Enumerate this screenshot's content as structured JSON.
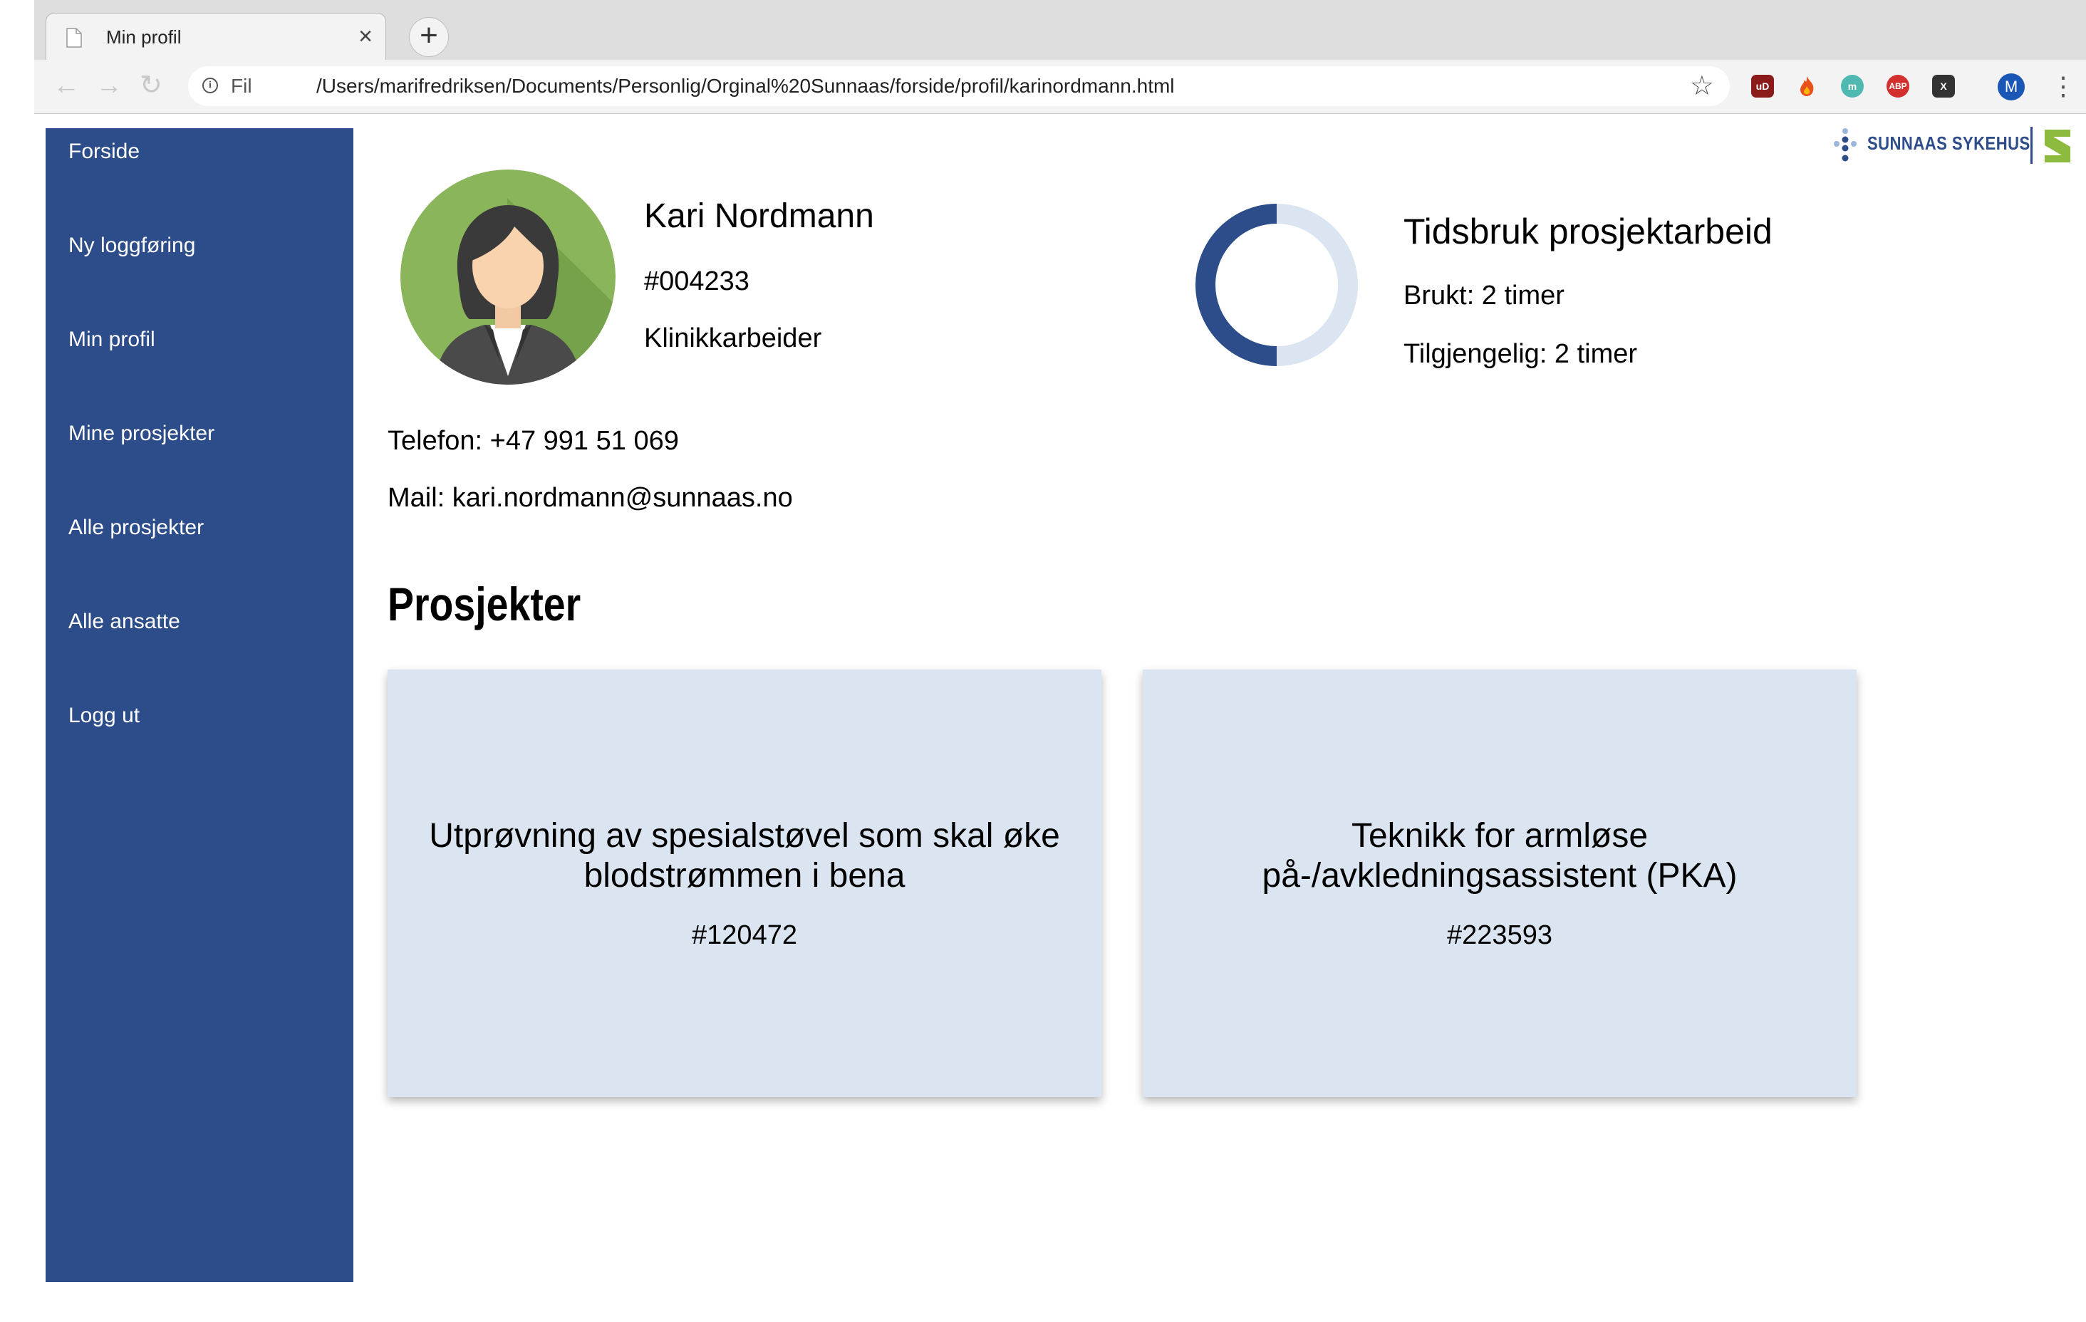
{
  "browser": {
    "tab_title": "Min profil",
    "tab_close": "×",
    "new_tab": "+",
    "scheme_label": "Fil",
    "url": "/Users/marifredriksen/Documents/Personlig/Orginal%20Sunnaas/forside/profil/karinordmann.html",
    "info_icon": "i",
    "extensions": [
      {
        "name": "ublock-icon",
        "label": "uD",
        "color": "#8b1a1a"
      },
      {
        "name": "flame-icon",
        "label": "🔥",
        "color": "transparent"
      },
      {
        "name": "mercury-icon",
        "label": "m",
        "color": "#4fb8b0"
      },
      {
        "name": "adblock-icon",
        "label": "ABP",
        "color": "#d32f2f"
      },
      {
        "name": "x-extension-icon",
        "label": "X",
        "color": "#333333"
      }
    ],
    "avatar_letter": "M"
  },
  "sidebar": {
    "items": [
      {
        "label": "Forside"
      },
      {
        "label": "Ny loggføring"
      },
      {
        "label": "Min profil"
      },
      {
        "label": "Mine prosjekter"
      },
      {
        "label": "Alle prosjekter"
      },
      {
        "label": "Alle ansatte"
      },
      {
        "label": "Logg ut"
      }
    ]
  },
  "logo": {
    "text": "SUNNAAS SYKEHUS"
  },
  "profile": {
    "name": "Kari Nordmann",
    "id": "#004233",
    "role": "Klinikkarbeider",
    "phone": "Telefon: +47 991 51 069",
    "mail": "Mail: kari.nordmann@sunnaas.no"
  },
  "time_usage": {
    "title": "Tidsbruk prosjektarbeid",
    "used_label": "Brukt: 2 timer",
    "available_label": "Tilgjengelig: 2 timer",
    "used_fraction": 0.5,
    "colors": {
      "used": "#2c4d89",
      "available": "#dbe5f1"
    }
  },
  "projects": {
    "title": "Prosjekter",
    "items": [
      {
        "title": "Utprøvning av spesialstøvel som skal øke blodstrømmen i bena",
        "id": "#120472"
      },
      {
        "title": "Teknikk for armløse på-/avkledningsassistent (PKA)",
        "id": "#223593"
      }
    ]
  },
  "colors": {
    "sidebar": "#2c4d89",
    "card": "#dbe5f1",
    "logo_green": "#8dbb3f"
  }
}
